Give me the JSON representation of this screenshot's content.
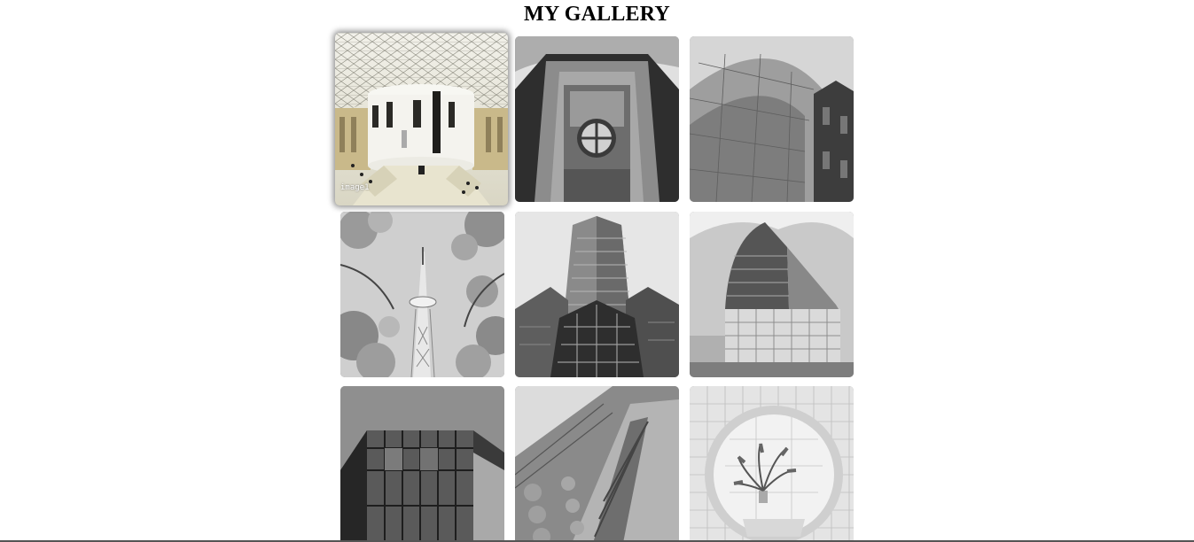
{
  "page": {
    "title": "MY GALLERY"
  },
  "gallery": {
    "items": [
      {
        "id": "image1",
        "caption": "image1",
        "subject": "museum-great-court-dome",
        "active": true
      },
      {
        "id": "image2",
        "caption": "",
        "subject": "stone-facade-round-window",
        "active": false
      },
      {
        "id": "image3",
        "caption": "",
        "subject": "curved-metal-building",
        "active": false
      },
      {
        "id": "image4",
        "caption": "",
        "subject": "tower-with-blossoms",
        "active": false
      },
      {
        "id": "image5",
        "caption": "",
        "subject": "glass-skyscraper-upward",
        "active": false
      },
      {
        "id": "image6",
        "caption": "",
        "subject": "curved-office-building",
        "active": false
      },
      {
        "id": "image7",
        "caption": "",
        "subject": "glass-facade-corner",
        "active": false
      },
      {
        "id": "image8",
        "caption": "",
        "subject": "ornate-building-upward",
        "active": false
      },
      {
        "id": "image9",
        "caption": "",
        "subject": "round-window-plant",
        "active": false
      }
    ]
  },
  "colors": {
    "background": "#ffffff",
    "title": "#000000"
  }
}
